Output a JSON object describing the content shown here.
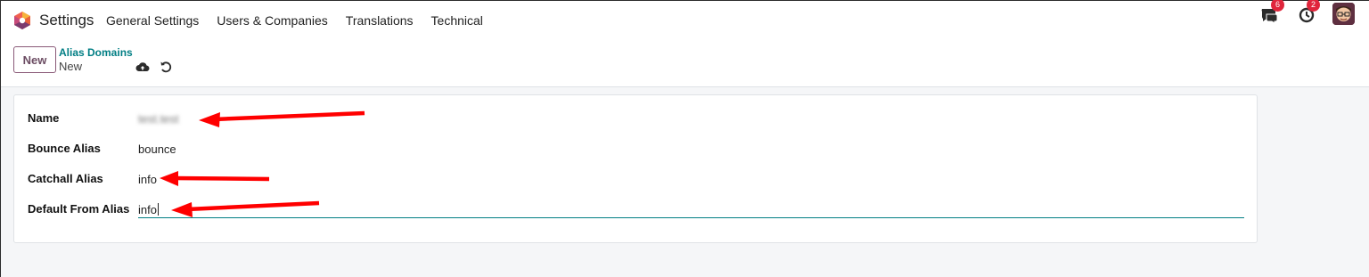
{
  "navbar": {
    "app_title": "Settings",
    "menu": [
      {
        "label": "General Settings"
      },
      {
        "label": "Users & Companies"
      },
      {
        "label": "Translations"
      },
      {
        "label": "Technical"
      }
    ],
    "messages_badge": "6",
    "activities_badge": "2"
  },
  "control_panel": {
    "new_button": "New",
    "breadcrumb_parent": "Alias Domains",
    "breadcrumb_current": "New"
  },
  "form": {
    "fields": [
      {
        "label": "Name",
        "value": "test.test"
      },
      {
        "label": "Bounce Alias",
        "value": "bounce"
      },
      {
        "label": "Catchall Alias",
        "value": "info"
      },
      {
        "label": "Default From Alias",
        "value": "info"
      }
    ]
  },
  "colors": {
    "brand_accent": "#017e84",
    "primary_button": "#8a5a78",
    "badge": "#e0263c",
    "annotation_arrow": "#ff0000"
  }
}
